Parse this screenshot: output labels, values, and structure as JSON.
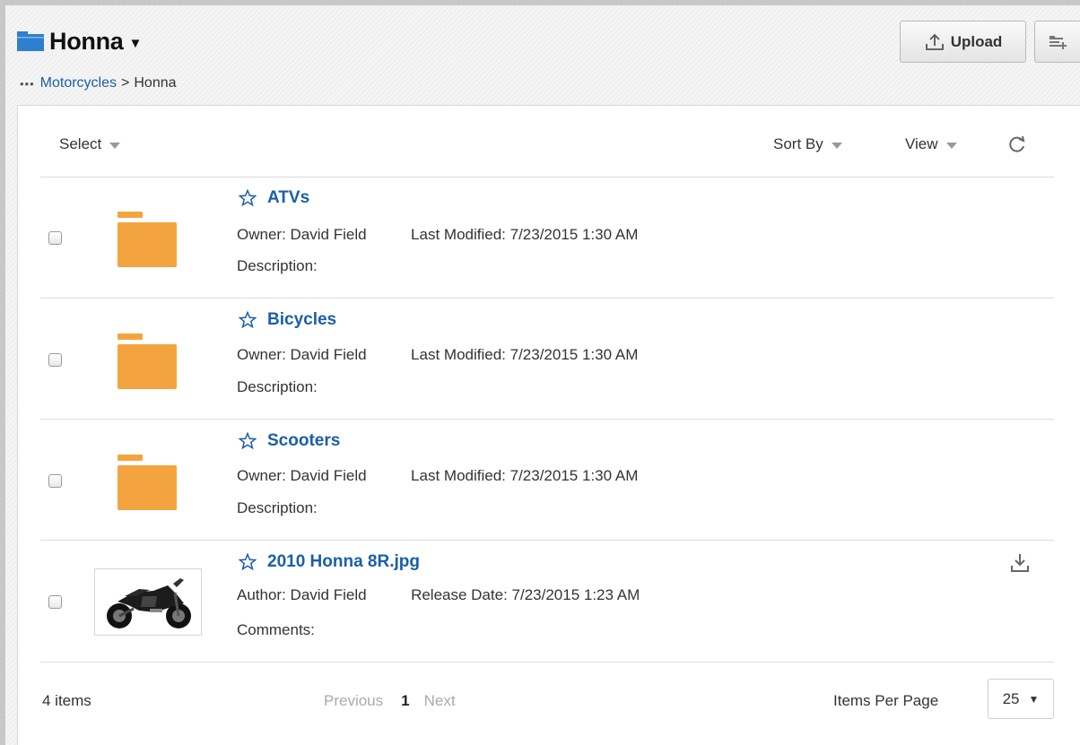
{
  "header": {
    "title": "Honna",
    "breadcrumb": {
      "dots": "•••",
      "parent": "Motorcycles",
      "separator": ">",
      "current": "Honna"
    },
    "upload_label": "Upload"
  },
  "toolbar": {
    "select_label": "Select",
    "sort_label": "Sort By",
    "view_label": "View"
  },
  "items": [
    {
      "name": "ATVs",
      "type": "folder",
      "person_label": "Owner:",
      "person": "David Field",
      "date_label": "Last Modified:",
      "date": "7/23/2015 1:30 AM",
      "extra_label": "Description:"
    },
    {
      "name": "Bicycles",
      "type": "folder",
      "person_label": "Owner:",
      "person": "David Field",
      "date_label": "Last Modified:",
      "date": "7/23/2015 1:30 AM",
      "extra_label": "Description:"
    },
    {
      "name": "Scooters",
      "type": "folder",
      "person_label": "Owner:",
      "person": "David Field",
      "date_label": "Last Modified:",
      "date": "7/23/2015 1:30 AM",
      "extra_label": "Description:"
    },
    {
      "name": "2010 Honna 8R.jpg",
      "type": "file",
      "person_label": "Author:",
      "person": "David Field",
      "date_label": "Release Date:",
      "date": "7/23/2015 1:23 AM",
      "extra_label": "Comments:"
    }
  ],
  "footer": {
    "count": "4 items",
    "prev": "Previous",
    "page": "1",
    "next": "Next",
    "items_per_page_label": "Items Per Page",
    "items_per_page": "25"
  },
  "colors": {
    "link": "#1a5fa8",
    "folder": "#f4a43f",
    "folder_title": "#2d7fd0"
  }
}
